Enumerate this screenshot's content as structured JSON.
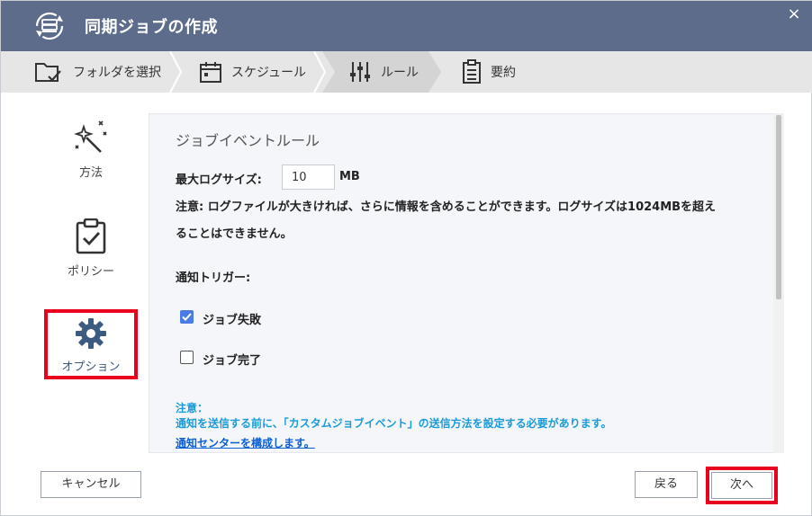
{
  "window": {
    "title": "同期ジョブの作成",
    "close_glyph": "×"
  },
  "steps": [
    {
      "label": "フォルダを選択",
      "icon": "folder-check-icon"
    },
    {
      "label": "スケジュール",
      "icon": "calendar-icon"
    },
    {
      "label": "ルール",
      "icon": "sliders-icon",
      "active": true
    },
    {
      "label": "要約",
      "icon": "clipboard-list-icon"
    }
  ],
  "nav": [
    {
      "label": "方法",
      "icon": "magic-wand-icon"
    },
    {
      "label": "ポリシー",
      "icon": "clipboard-check-icon"
    },
    {
      "label": "オプション",
      "icon": "gear-icon",
      "selected": true
    }
  ],
  "content": {
    "section_title": "ジョブイベントルール",
    "max_log_label": "最大ログサイズ:",
    "max_log_value": "10",
    "max_log_unit": "MB",
    "note_line1": "注意: ログファイルが大きければ、さらに情報を含めることができます。ログサイズは1024MBを超え",
    "note_line2": "ることはできません。",
    "trigger_label": "通知トリガー:",
    "checkboxes": [
      {
        "label": "ジョブ失敗",
        "checked": true
      },
      {
        "label": "ジョブ完了",
        "checked": false
      }
    ],
    "blue_note_title": "注意：",
    "blue_note_body": "通知を送信する前に、「カスタムジョブイベント」の送信方法を設定する必要があります。",
    "link_text": "通知センターを構成します。"
  },
  "footer": {
    "cancel": "キャンセル",
    "back": "戻る",
    "next": "次へ"
  },
  "colors": {
    "titlebar": "#5d6c8b",
    "accent_blue": "#4b7be5",
    "note_blue": "#1a9bd7",
    "highlight_red": "#e8001c"
  }
}
